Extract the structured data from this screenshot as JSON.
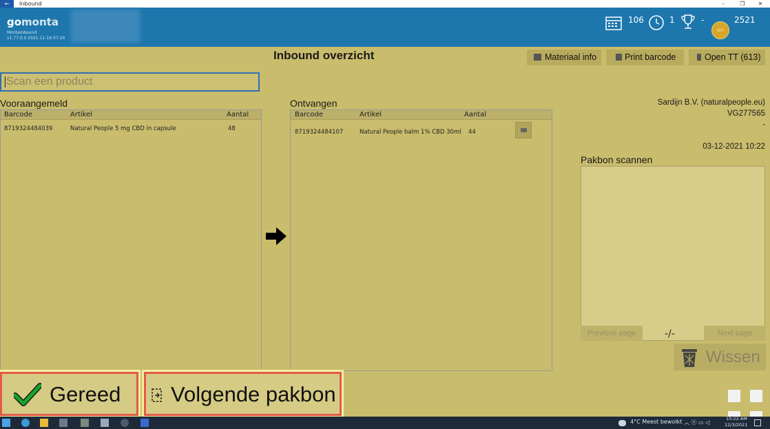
{
  "window": {
    "title": "Inbound"
  },
  "header": {
    "logo_go": "go",
    "logo_monta": "monta",
    "app_name": "MontaInbound",
    "version": "v1.77.0.0  2021-11-16 07:24",
    "calendar_count": "106",
    "clock_count": "1",
    "trophy_value": "-",
    "coin_label": "en",
    "coins": "2521"
  },
  "page_title": "Inbound overzicht",
  "toolbar": {
    "materiaal_info": "Materiaal info",
    "print_barcode": "Print barcode",
    "open_tt": "Open TT (613)"
  },
  "scan": {
    "placeholder": "Scan een product"
  },
  "vooraangemeld": {
    "label": "Vooraangemeld",
    "columns": [
      "Barcode",
      "Artikel",
      "Aantal"
    ],
    "rows": [
      {
        "barcode": "8719324484039",
        "artikel": "Natural People 5 mg CBD in capsule",
        "aantal": "48"
      }
    ]
  },
  "ontvangen": {
    "label": "Ontvangen",
    "columns": [
      "Barcode",
      "Artikel",
      "Aantal"
    ],
    "rows": [
      {
        "barcode": "8719324484107",
        "artikel": "Natural People balm 1% CBD 30ml",
        "aantal": "44"
      }
    ]
  },
  "supplier": {
    "name": "Sardijn B.V. (naturalpeople.eu)",
    "code": "VG277565",
    "dash": "-",
    "datetime": "03-12-2021 10:22"
  },
  "pakbon": {
    "label": "Pakbon scannen",
    "previous": "Previous page",
    "indicator": "-/-",
    "next": "Next page",
    "wissen": "Wissen"
  },
  "actions": {
    "gereed": "Gereed",
    "volgende": "Volgende pakbon"
  },
  "taskbar": {
    "weather": "4°C  Meest bewolkt",
    "time": "10:22 AM",
    "date": "12/3/2021"
  },
  "colors": {
    "background": "#c9bc6c",
    "header": "#1d77ad",
    "highlight_border": "#e25a4a",
    "check": "#1aa32a"
  }
}
